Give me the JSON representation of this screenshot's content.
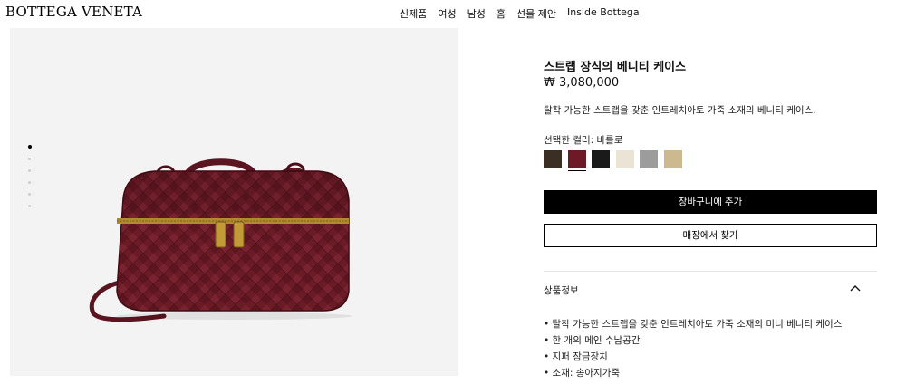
{
  "brand": {
    "logo": "BOTTEGA VENETA"
  },
  "nav": [
    "신제품",
    "여성",
    "남성",
    "홈",
    "선물 제안",
    "Inside Bottega"
  ],
  "gallery": {
    "dots": 6,
    "active_index": 0
  },
  "product": {
    "title": "스트랩 장식의 베니티 케이스",
    "price": "₩ 3,080,000",
    "description": "탈착 가능한 스트랩을 갖춘 인트레치아토 가죽 소재의 베니티 케이스.",
    "color_label": "선택한 컬러: 바롤로",
    "swatches": [
      {
        "name": "dark-brown",
        "color": "#3b2e22",
        "selected": false
      },
      {
        "name": "barolo",
        "color": "#6d1a26",
        "selected": true
      },
      {
        "name": "black",
        "color": "#1a1a1a",
        "selected": false
      },
      {
        "name": "cream",
        "color": "#ebe4d4",
        "selected": false
      },
      {
        "name": "grey",
        "color": "#9c9c9c",
        "selected": false
      },
      {
        "name": "beige",
        "color": "#cdb98f",
        "selected": false
      }
    ]
  },
  "actions": {
    "add_to_cart": "장바구니에 추가",
    "find_store": "매장에서 찾기"
  },
  "accordion": {
    "label": "상품정보",
    "icon": "chevron-up-icon",
    "items": [
      "탈착 가능한 스트랩을 갖춘 인트레치아토 가죽 소재의 미니 베니티 케이스",
      "한 개의 메인 수납공간",
      "지퍼 잠금장치",
      "소재: 송아지가죽"
    ]
  }
}
